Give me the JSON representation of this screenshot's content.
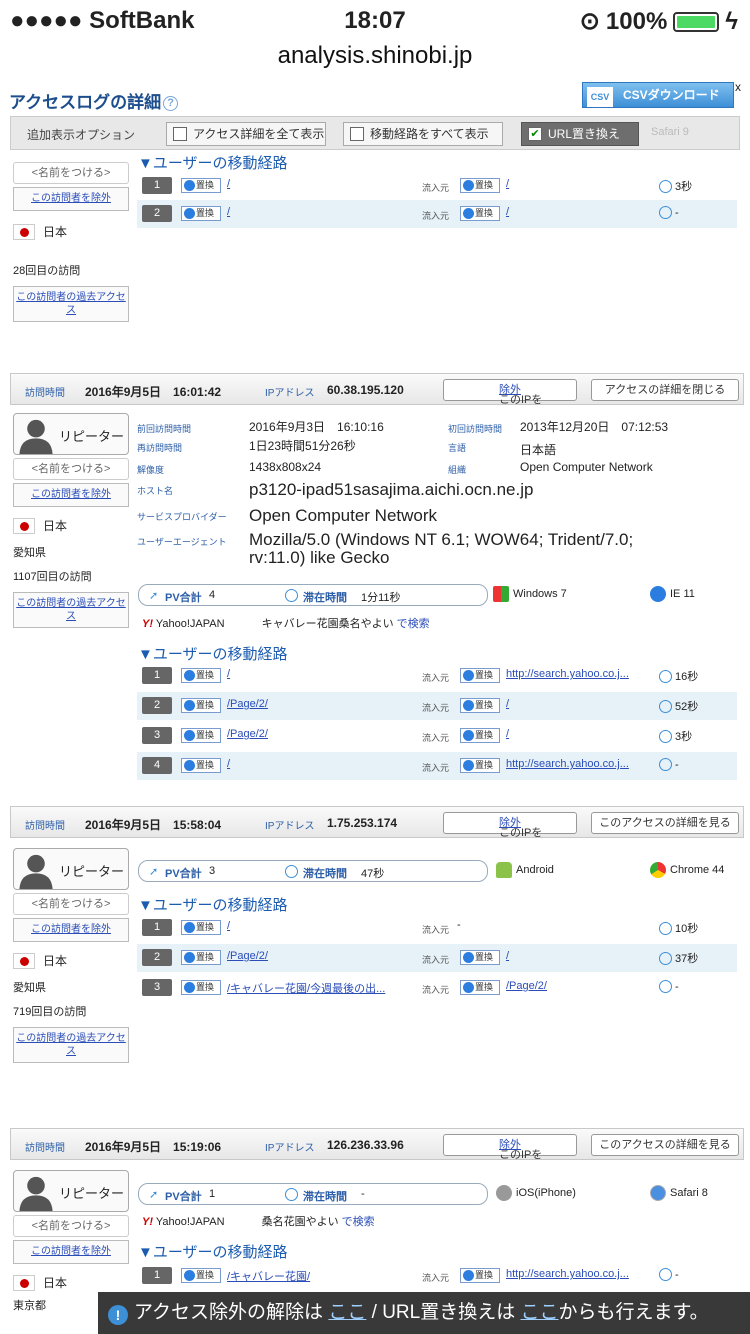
{
  "status_bar": {
    "carrier": "●●●●● SoftBank",
    "time": "18:07",
    "battery": "100%"
  },
  "browser": {
    "url": "analysis.shinobi.jp"
  },
  "toolbar": {
    "title": "アクセスログの詳細",
    "csv_label": "CSVダウンロード",
    "csv_icon_text": "CSV",
    "close": "x",
    "option_label": "追加表示オプション",
    "opt_show_all_details": "アクセス詳細を全て表示",
    "opt_show_all_paths": "移動経路をすべて表示",
    "opt_url_replace": "URL置き換え",
    "bg_browser": "Safari 9"
  },
  "common": {
    "name_placeholder": "<名前をつける>",
    "exclude_visitor": "この訪問者を除外",
    "past_access": "この訪問者の過去アクセス",
    "repeater": "リピーター",
    "visit_time": "訪問時間",
    "ip_label": "IPアドレス",
    "this_ip": "このIPを",
    "exclude": "除外",
    "show_detail": "このアクセスの詳細を見る",
    "close_detail": "アクセスの詳細を閉じる",
    "path_title": "▼ユーザーの移動経路",
    "replace": "置換",
    "source": "流入元",
    "pv_total": "PV合計",
    "stay_time": "滞在時間",
    "search": "で検索",
    "yahoo": "Yahoo!JAPAN"
  },
  "visitor0": {
    "country": "日本",
    "visit_count": "28回目の訪問",
    "steps": [
      {
        "n": "1",
        "page": "/",
        "source": "/",
        "time": "3秒"
      },
      {
        "n": "2",
        "page": "/",
        "source": "/",
        "time": "-"
      }
    ]
  },
  "visitor1": {
    "date": "2016年9月5日　16:01:42",
    "ip": "60.38.195.120",
    "country": "日本",
    "pref": "愛知県",
    "visit_count": "1107回目の訪問",
    "details": {
      "prev_visit_label": "前回訪問時間",
      "prev_visit": "2016年9月3日　16:10:16",
      "first_visit_label": "初回訪問時間",
      "first_visit": "2013年12月20日　07:12:53",
      "revisit_label": "再訪問時間",
      "revisit": "1日23時間51分26秒",
      "lang_label": "言語",
      "lang": "日本語",
      "res_label": "解像度",
      "res": "1438x808x24",
      "org_label": "組織",
      "org": "Open Computer Network",
      "host_label": "ホスト名",
      "host": "p3120-ipad51sasajima.aichi.ocn.ne.jp",
      "isp_label": "サービスプロバイダー",
      "isp": "Open Computer Network",
      "ua_label": "ユーザーエージェント",
      "ua": "Mozilla/5.0 (Windows NT 6.1; WOW64; Trident/7.0; rv:11.0) like Gecko"
    },
    "pv": "4",
    "stay": "1分11秒",
    "os": "Windows 7",
    "browser": "IE 11",
    "keyword": "キャバレー花園桑名やよい",
    "steps": [
      {
        "n": "1",
        "page": "/",
        "source": "http://search.yahoo.co.j...",
        "time": "16秒"
      },
      {
        "n": "2",
        "page": "/Page/2/",
        "source": "/",
        "time": "52秒"
      },
      {
        "n": "3",
        "page": "/Page/2/",
        "source": "/",
        "time": "3秒"
      },
      {
        "n": "4",
        "page": "/",
        "source": "http://search.yahoo.co.j...",
        "time": "-"
      }
    ]
  },
  "visitor2": {
    "date": "2016年9月5日　15:58:04",
    "ip": "1.75.253.174",
    "country": "日本",
    "pref": "愛知県",
    "visit_count": "719回目の訪問",
    "pv": "3",
    "stay": "47秒",
    "os": "Android",
    "browser": "Chrome 44",
    "steps": [
      {
        "n": "1",
        "page": "/",
        "source": "-",
        "time": "10秒"
      },
      {
        "n": "2",
        "page": "/Page/2/",
        "source": "/",
        "time": "37秒"
      },
      {
        "n": "3",
        "page": "/キャバレー花園/今週最後の出...",
        "source": "/Page/2/",
        "time": "-"
      }
    ]
  },
  "visitor3": {
    "date": "2016年9月5日　15:19:06",
    "ip": "126.236.33.96",
    "country": "日本",
    "pref": "東京都",
    "pv": "1",
    "stay": "-",
    "os": "iOS(iPhone)",
    "browser": "Safari 8",
    "keyword": "桑名花園やよい",
    "steps": [
      {
        "n": "1",
        "page": "/キャバレー花園/",
        "source": "http://search.yahoo.co.j...",
        "time": "-"
      }
    ]
  },
  "footer": {
    "text1": "アクセス除外の解除は",
    "link1": "ここ",
    "text2": " / URL置き換えは",
    "link2": "ここ",
    "text3": "からも行えます。"
  }
}
